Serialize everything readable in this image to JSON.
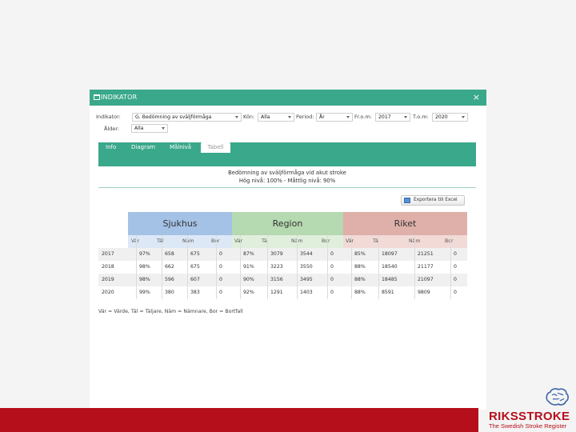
{
  "dialog": {
    "title": "INDIKATOR",
    "close": "×"
  },
  "filters": {
    "indikator": {
      "label": "Indikator:",
      "value": "G. Bedömning av sväljförmåga"
    },
    "kon": {
      "label": "Kön:",
      "value": "Alla"
    },
    "period": {
      "label": "Period:",
      "value": "År"
    },
    "from": {
      "label": "Fr.o.m:",
      "value": "2017"
    },
    "tom": {
      "label": "T.o.m:",
      "value": "2020"
    },
    "alder": {
      "label": "Ålder:",
      "value": "Alla"
    }
  },
  "tabs": [
    "Info",
    "Diagram",
    "Målnivå",
    "Tabell"
  ],
  "active_tab": "Tabell",
  "content": {
    "title": "Bedömning av sväljförmåga vid akut stroke",
    "subtitle": "Hög nivå: 100% - Måttlig nivå: 90%",
    "export_label": "Exportera till Excel"
  },
  "table": {
    "groups": [
      {
        "name": "Sjukhus",
        "color": "#a4c2e6"
      },
      {
        "name": "Region",
        "color": "#b5d9b0"
      },
      {
        "name": "Riket",
        "color": "#dfb0aa"
      }
    ],
    "subheaders": [
      "Vär",
      "Täl",
      "Näm",
      "Bor"
    ],
    "rows": [
      {
        "year": "2017",
        "values": [
          "97%",
          "658",
          "675",
          "0",
          "87%",
          "3079",
          "3544",
          "0",
          "85%",
          "18097",
          "21251",
          "0"
        ]
      },
      {
        "year": "2018",
        "values": [
          "98%",
          "662",
          "675",
          "0",
          "91%",
          "3223",
          "3550",
          "0",
          "88%",
          "18540",
          "21177",
          "0"
        ]
      },
      {
        "year": "2019",
        "values": [
          "98%",
          "596",
          "607",
          "0",
          "90%",
          "3156",
          "3495",
          "0",
          "88%",
          "18485",
          "21097",
          "0"
        ]
      },
      {
        "year": "2020",
        "values": [
          "99%",
          "380",
          "383",
          "0",
          "92%",
          "1291",
          "1403",
          "0",
          "88%",
          "8591",
          "9809",
          "0"
        ]
      }
    ],
    "legend": "Vär = Värde, Täl = Täljare, Näm = Nämnare, Bor = Bortfall"
  },
  "brand": {
    "name": "RIKSSTROKE",
    "tagline": "The Swedish Stroke Register",
    "color": "#b50f1c"
  }
}
